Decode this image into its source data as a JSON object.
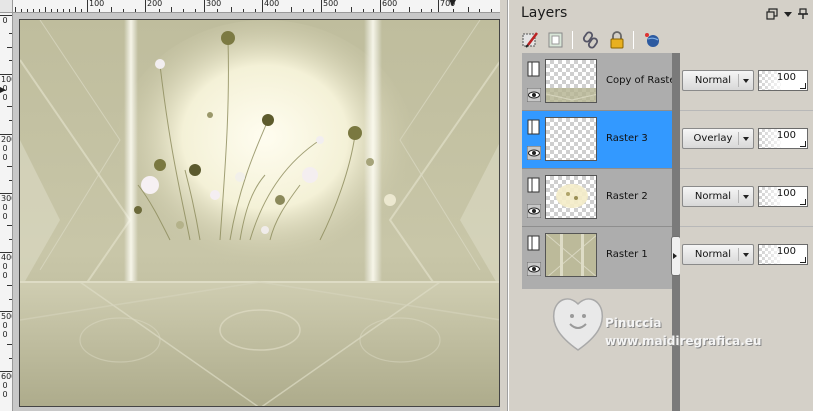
{
  "ruler": {
    "h_labels": [
      "100",
      "200",
      "300",
      "400",
      "500",
      "600",
      "700"
    ],
    "v_labels": [
      "0",
      "100",
      "200",
      "300",
      "400",
      "500",
      "600"
    ]
  },
  "palette": {
    "title": "Layers",
    "header_icons": [
      "float-icon",
      "menu-arrow-icon",
      "pin-icon"
    ],
    "toolbar_icons": [
      "edit-selection-icon",
      "mask-icon",
      "link-icon",
      "lock-icon",
      "globe-icon"
    ]
  },
  "layers": [
    {
      "name": "Copy of Raster 1",
      "blend_mode": "Normal",
      "opacity": "100",
      "visible": true,
      "active": false
    },
    {
      "name": "Raster 3",
      "blend_mode": "Overlay",
      "opacity": "100",
      "visible": true,
      "active": true
    },
    {
      "name": "Raster 2",
      "blend_mode": "Normal",
      "opacity": "100",
      "visible": true,
      "active": false
    },
    {
      "name": "Raster 1",
      "blend_mode": "Normal",
      "opacity": "100",
      "visible": true,
      "active": false
    }
  ],
  "watermark": {
    "line1": "Pinuccia",
    "line2": "www.maidiregrafica.eu"
  },
  "colors": {
    "active_row": "#3399ff",
    "layer_row": "#adadad",
    "panel_bg": "#d4d0c8"
  }
}
